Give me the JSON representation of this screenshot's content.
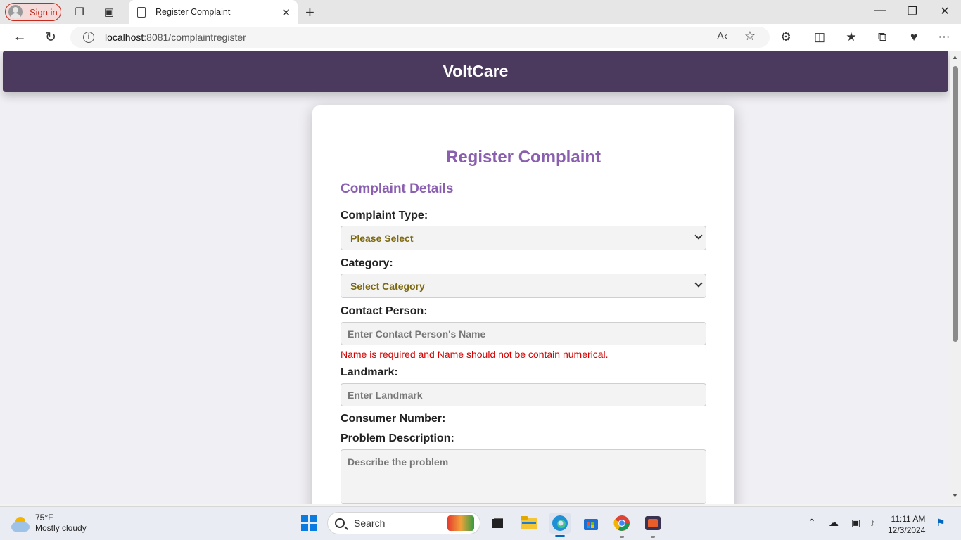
{
  "browser": {
    "signin_label": "Sign in",
    "tab_title": "Register Complaint",
    "url_host": "localhost",
    "url_rest": ":8081/complaintregister"
  },
  "app": {
    "brand": "VoltCare"
  },
  "form": {
    "title": "Register Complaint",
    "section_title": "Complaint Details",
    "complaint_type_label": "Complaint Type:",
    "complaint_type_value": "Please Select",
    "category_label": "Category:",
    "category_value": "Select Category",
    "contact_person_label": "Contact Person:",
    "contact_person_placeholder": "Enter Contact Person's Name",
    "contact_person_error": "Name is required and Name should not be contain numerical.",
    "landmark_label": "Landmark:",
    "landmark_placeholder": "Enter Landmark",
    "consumer_number_label": "Consumer Number:",
    "problem_description_label": "Problem Description:",
    "problem_description_placeholder": "Describe the problem"
  },
  "taskbar": {
    "temperature": "75°F",
    "weather": "Mostly cloudy",
    "search_label": "Search",
    "time": "11:11 AM",
    "date": "12/3/2024"
  },
  "colors": {
    "header_bg": "#4b3a5e",
    "accent": "#8a5fb0",
    "error": "#d40000",
    "select_text": "#7d6a10"
  }
}
